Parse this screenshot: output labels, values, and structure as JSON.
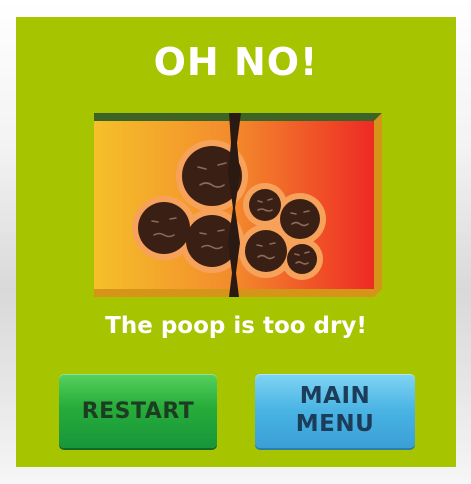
{
  "dialog": {
    "title": "OH NO!",
    "message": "The poop is too dry!",
    "illustration": "dry-poop-balls-split-by-crack"
  },
  "buttons": {
    "restart_label": "RESTART",
    "menu_label_line1": "MAIN",
    "menu_label_line2": "MENU"
  },
  "colors": {
    "panel": "#a6c400",
    "restart_button": "#27ac3a",
    "menu_button": "#49b3e4",
    "scene_gradient_left": "#f5c02a",
    "scene_gradient_right": "#ee2a24"
  }
}
